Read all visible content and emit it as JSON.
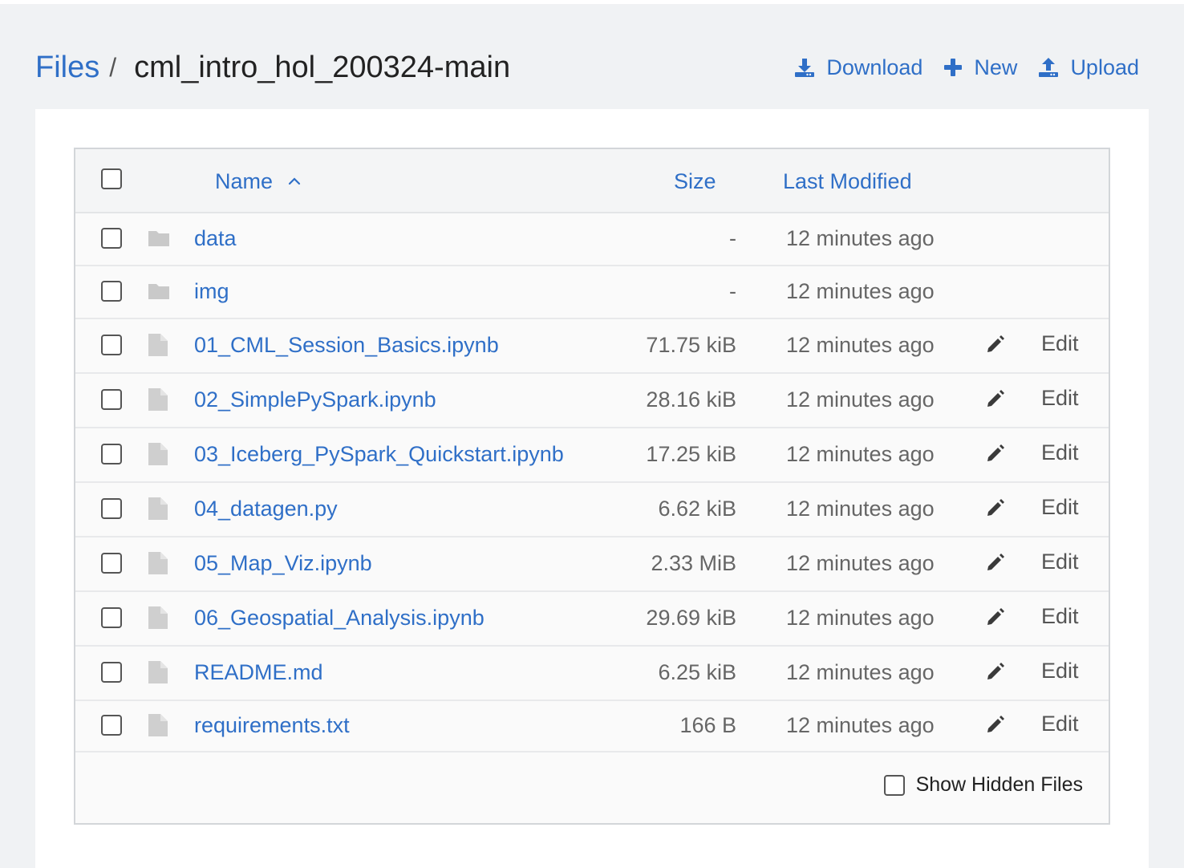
{
  "breadcrumb": {
    "root": "Files",
    "separator": "/",
    "current": "cml_intro_hol_200324-main"
  },
  "actions": {
    "download": "Download",
    "new": "New",
    "upload": "Upload"
  },
  "table": {
    "headers": {
      "name": "Name",
      "size": "Size",
      "modified": "Last Modified"
    },
    "sort": {
      "column": "name",
      "direction": "ascending"
    },
    "rows": [
      {
        "type": "folder",
        "name": "data",
        "size": "-",
        "modified": "12 minutes ago",
        "edit": ""
      },
      {
        "type": "folder",
        "name": "img",
        "size": "-",
        "modified": "12 minutes ago",
        "edit": ""
      },
      {
        "type": "file",
        "name": "01_CML_Session_Basics.ipynb",
        "size": "71.75 kiB",
        "modified": "12 minutes ago",
        "edit": "Edit"
      },
      {
        "type": "file",
        "name": "02_SimplePySpark.ipynb",
        "size": "28.16 kiB",
        "modified": "12 minutes ago",
        "edit": "Edit"
      },
      {
        "type": "file",
        "name": "03_Iceberg_PySpark_Quickstart.ipynb",
        "size": "17.25 kiB",
        "modified": "12 minutes ago",
        "edit": "Edit"
      },
      {
        "type": "file",
        "name": "04_datagen.py",
        "size": "6.62 kiB",
        "modified": "12 minutes ago",
        "edit": "Edit"
      },
      {
        "type": "file",
        "name": "05_Map_Viz.ipynb",
        "size": "2.33 MiB",
        "modified": "12 minutes ago",
        "edit": "Edit"
      },
      {
        "type": "file",
        "name": "06_Geospatial_Analysis.ipynb",
        "size": "29.69 kiB",
        "modified": "12 minutes ago",
        "edit": "Edit"
      },
      {
        "type": "file",
        "name": "README.md",
        "size": "6.25 kiB",
        "modified": "12 minutes ago",
        "edit": "Edit"
      },
      {
        "type": "file",
        "name": "requirements.txt",
        "size": "166 B",
        "modified": "12 minutes ago",
        "edit": "Edit"
      }
    ]
  },
  "footer": {
    "show_hidden_label": "Show Hidden Files"
  },
  "colors": {
    "link": "#2f6fc7",
    "background": "#f0f2f4",
    "panel": "#ffffff",
    "icon_gray": "#c9c9c9"
  }
}
